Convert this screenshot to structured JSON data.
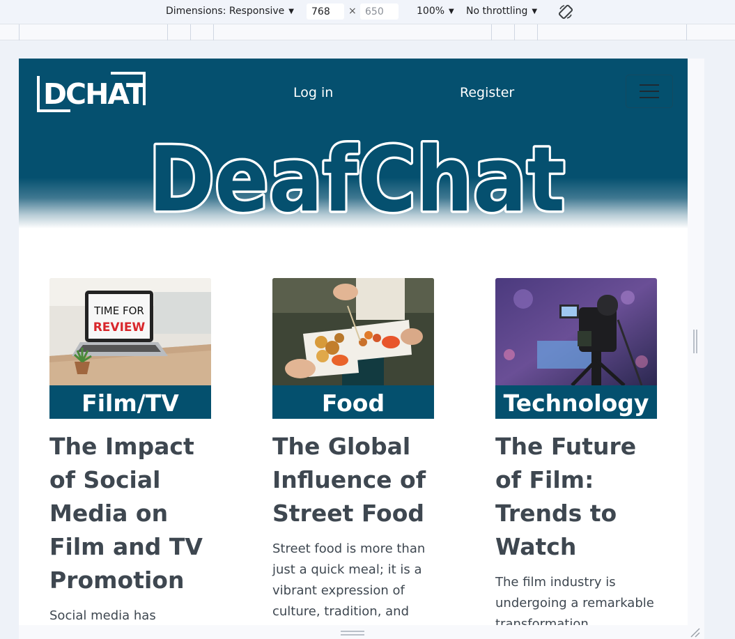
{
  "devtools": {
    "dimensions_label": "Dimensions: Responsive",
    "width_value": "768",
    "height_value": "650",
    "times_symbol": "×",
    "zoom_label": "100%",
    "throttling_label": "No throttling",
    "icons": [
      "caret-down-icon",
      "rotate-icon",
      "resize-handle-icon"
    ]
  },
  "site": {
    "logo_text": "DCHAT",
    "nav": {
      "login": "Log in",
      "register": "Register"
    },
    "title": "DeafChat",
    "colors": {
      "brand": "#04506e",
      "text": "#3e4750",
      "title_fill": "#05506f",
      "title_stroke": "#ffffff"
    }
  },
  "cards": [
    {
      "category": "Film/TV",
      "title": "The Impact of Social Media on Film and TV Promotion",
      "excerpt": "Social media has",
      "image": "laptop-time-for-review",
      "image_text": [
        "TIME FOR",
        "REVIEW"
      ]
    },
    {
      "category": "Food",
      "title": "The Global Influence of Street Food",
      "excerpt": "Street food is more than just a quick meal; it is a vibrant expression of culture, tradition, and",
      "image": "street-food-trays"
    },
    {
      "category": "Technology",
      "title": "The Future of Film: Trends to Watch",
      "excerpt": "The film industry is undergoing a remarkable transformation",
      "image": "video-camera-stage"
    }
  ]
}
